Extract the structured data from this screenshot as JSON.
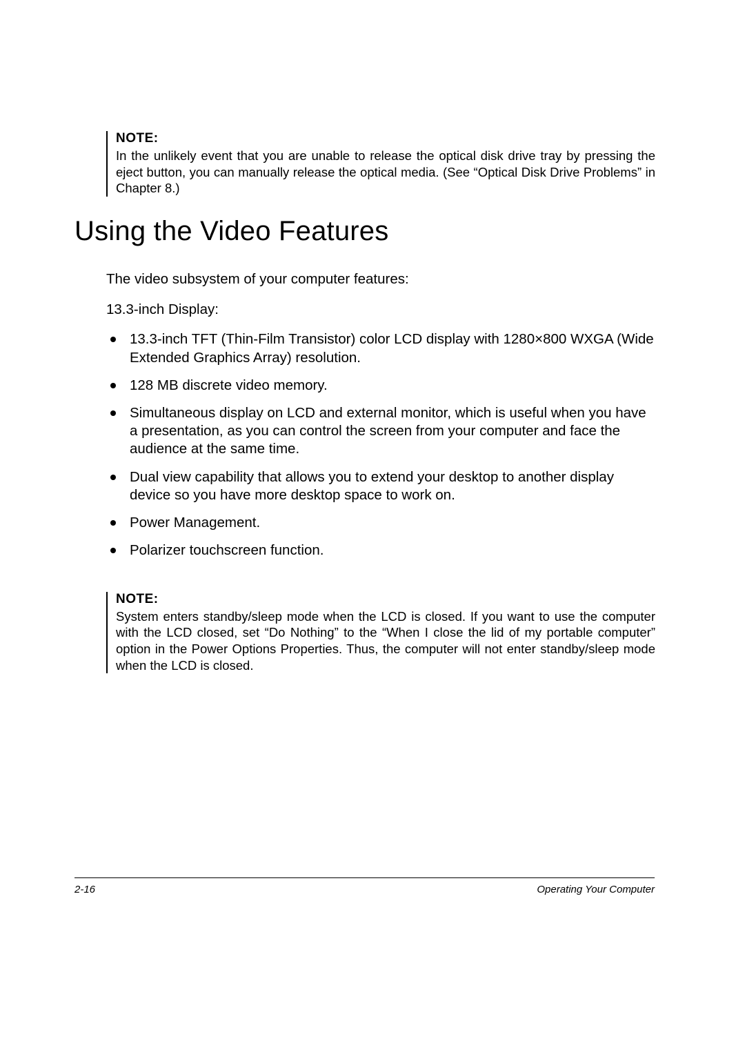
{
  "notes": {
    "top": {
      "label": "NOTE:",
      "text": "In the unlikely event that you are unable to release the optical disk drive tray by pressing the eject button, you can manually release the optical media. (See “Optical Disk Drive Problems” in Chapter 8.)"
    },
    "bottom": {
      "label": "NOTE:",
      "text": "System enters standby/sleep mode when the LCD is closed. If you want to use the computer with the LCD closed, set “Do Nothing” to the “When I close the lid of my portable computer” option in the Power Options Properties. Thus, the computer will not enter standby/sleep mode when the LCD is closed."
    }
  },
  "heading": "Using the Video Features",
  "intro": "The video subsystem of your computer features:",
  "subhead": "13.3-inch Display:",
  "features": [
    "13.3-inch TFT (Thin-Film Transistor) color LCD display with 1280×800 WXGA (Wide Extended Graphics Array) resolution.",
    "128 MB discrete video memory.",
    "Simultaneous display on LCD and external monitor, which is useful when you have a presentation, as you can control the screen from your computer and face the audience at the same time.",
    "Dual view capability that allows you to extend your desktop to another display device so you have more desktop space to work on.",
    "Power Management.",
    "Polarizer touchscreen function."
  ],
  "footer": {
    "page": "2-16",
    "title": "Operating Your Computer"
  }
}
